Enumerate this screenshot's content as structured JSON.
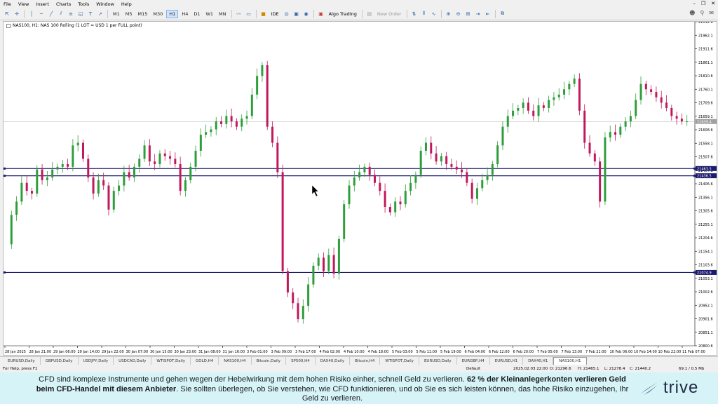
{
  "menu": [
    "File",
    "View",
    "Insert",
    "Charts",
    "Tools",
    "Window",
    "Help"
  ],
  "toolbar": {
    "timeframes": [
      "M1",
      "M5",
      "M15",
      "M30",
      "H1",
      "H4",
      "D1",
      "W1",
      "MN"
    ],
    "active_timeframe": "H1",
    "ide_label": "IDE",
    "algo_label": "Algo Trading",
    "new_order_label": "New Order"
  },
  "chart_header": {
    "label": "NAS100, H1:  NAS 100 Rolling (1 LOT = USD 1 per FULL point)"
  },
  "chart_data": {
    "type": "candlestick",
    "price_axis": [
      "22012.6",
      "21962.1",
      "21911.6",
      "21861.1",
      "21810.6",
      "21760.1",
      "21709.6",
      "21659.1",
      "21608.6",
      "21558.1",
      "21507.6",
      "21457.1",
      "21406.6",
      "21356.1",
      "21305.6",
      "21255.1",
      "21204.6",
      "21154.1",
      "21103.6",
      "21053.1",
      "21002.6",
      "20952.1",
      "20901.6",
      "20851.1",
      "20800.6"
    ],
    "time_axis": [
      "28 Jan 2025",
      "28 Jan 21:00",
      "29 Jan 06:00",
      "29 Jan 14:00",
      "29 Jan 22:00",
      "30 Jan 07:00",
      "30 Jan 15:00",
      "30 Jan 23:00",
      "31 Jan 08:00",
      "31 Jan 16:00",
      "3 Feb 01:00",
      "3 Feb 09:00",
      "3 Feb 17:00",
      "4 Feb 02:00",
      "4 Feb 10:00",
      "4 Feb 18:00",
      "5 Feb 03:00",
      "5 Feb 11:00",
      "5 Feb 19:00",
      "6 Feb 04:00",
      "6 Feb 12:00",
      "6 Feb 20:00",
      "7 Feb 05:00",
      "7 Feb 13:00",
      "7 Feb 21:00",
      "10 Feb 06:00",
      "10 Feb 14:00",
      "10 Feb 22:00",
      "11 Feb 07:00"
    ],
    "current_price": "21639.4",
    "horizontal_lines": [
      {
        "label": "21463.5",
        "price": 21463.5
      },
      {
        "label": "21436.5",
        "price": 21436.5
      },
      {
        "label": "21074.9",
        "price": 21074.9
      }
    ],
    "candles": [
      21180,
      21290,
      21340,
      21410,
      21380,
      21370,
      21460,
      21420,
      21430,
      21460,
      21470,
      21480,
      21470,
      21550,
      21560,
      21500,
      21430,
      21370,
      21420,
      21400,
      21310,
      21380,
      21400,
      21450,
      21430,
      21470,
      21500,
      21550,
      21490,
      21480,
      21520,
      21510,
      21500,
      21480,
      21380,
      21420,
      21470,
      21530,
      21590,
      21600,
      21610,
      21640,
      21630,
      21660,
      21640,
      21620,
      21650,
      21660,
      21740,
      21810,
      21850,
      21620,
      21560,
      21450,
      21080,
      21000,
      20960,
      20900,
      20950,
      21030,
      21100,
      21130,
      21080,
      21140,
      21070,
      21200,
      21330,
      21400,
      21430,
      21450,
      21470,
      21440,
      21410,
      21380,
      21320,
      21300,
      21340,
      21330,
      21380,
      21410,
      21440,
      21530,
      21560,
      21520,
      21490,
      21510,
      21480,
      21470,
      21460,
      21450,
      21410,
      21350,
      21390,
      21420,
      21440,
      21480,
      21550,
      21620,
      21660,
      21680,
      21690,
      21710,
      21680,
      21660,
      21700,
      21690,
      21720,
      21730,
      21740,
      21760,
      21780,
      21800,
      21680,
      21560,
      21520,
      21490,
      21340,
      21580,
      21600,
      21590,
      21620,
      21640,
      21660,
      21720,
      21780,
      21760,
      21750,
      21730,
      21710,
      21690,
      21660,
      21650,
      21640,
      21640
    ]
  },
  "tabs": [
    "EURUSD,Daily",
    "GBPUSD,Daily",
    "USDJPY,Daily",
    "USDCAD,Daily",
    "WTISPOT,Daily",
    "GOLD,H4",
    "NAS100,H4",
    "Bitcoin,Daily",
    "SP500,H4",
    "DAX40,Daily",
    "Bitcoin,H4",
    "WTISPOT,Daily",
    "EURUSD,Daily",
    "EURGBP,H4",
    "EURUSD,H1",
    "DAX40,H1",
    "NAS100,H1"
  ],
  "active_tab": "NAS100,H1",
  "status": {
    "help": "For Help, press F1",
    "profile": "Default",
    "datetime": "2025.02.03 22:00",
    "open": "O: 21296.6",
    "high": "H: 21465.1",
    "low": "L: 21278.4",
    "close": "C: 21440.2",
    "connection": "69.1 / 0.5 Mb"
  },
  "disclaimer": {
    "part1": "CFD sind komplexe Instrumente und gehen wegen der Hebelwirkung mit dem hohen Risiko einher, schnell Geld zu verlieren. ",
    "bold": "62 % der Kleinanlegerkonten verlieren Geld beim CFD-Handel mit diesem Anbieter",
    "part2": ". Sie sollten überlegen, ob Sie verstehen, wie CFD funktionieren, und ob Sie es sich leisten können, das hohe Risiko einzugehen, Ihr Geld zu verlieren."
  },
  "brand": "trive",
  "colors": {
    "bull": "#2e9e3a",
    "bear": "#c2185b",
    "level_line": "#1a1a6e",
    "disclaimer_bg": "#d6f3f7"
  }
}
